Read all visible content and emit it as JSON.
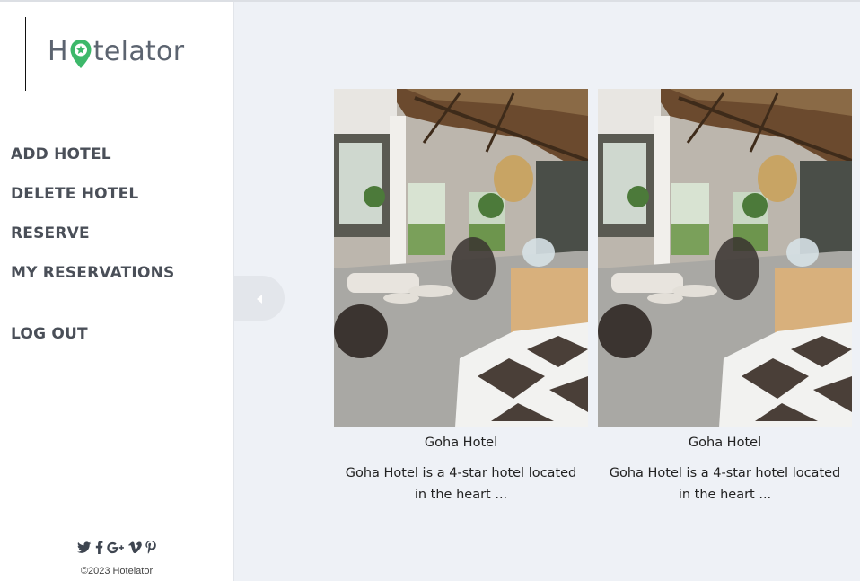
{
  "app": {
    "logo_before": "H",
    "logo_after": "telator"
  },
  "sidebar": {
    "items": [
      {
        "label": "ADD HOTEL"
      },
      {
        "label": "DELETE HOTEL"
      },
      {
        "label": "RESERVE"
      },
      {
        "label": "MY RESERVATIONS"
      }
    ],
    "logout_label": "LOG OUT",
    "social_icons": [
      "twitter-icon",
      "facebook-icon",
      "google-plus-icon",
      "vimeo-icon",
      "pinterest-icon"
    ],
    "copyright": "©2023 Hotelator"
  },
  "colors": {
    "brand_green": "#3db86a",
    "sidebar_text": "#4a4f58",
    "page_bg": "#eef1f6"
  },
  "hotels": [
    {
      "name": "Goha Hotel",
      "description": "Goha Hotel is a 4-star hotel located in the heart ..."
    },
    {
      "name": "Goha Hotel",
      "description": "Goha Hotel is a 4-star hotel located in the heart ..."
    }
  ]
}
